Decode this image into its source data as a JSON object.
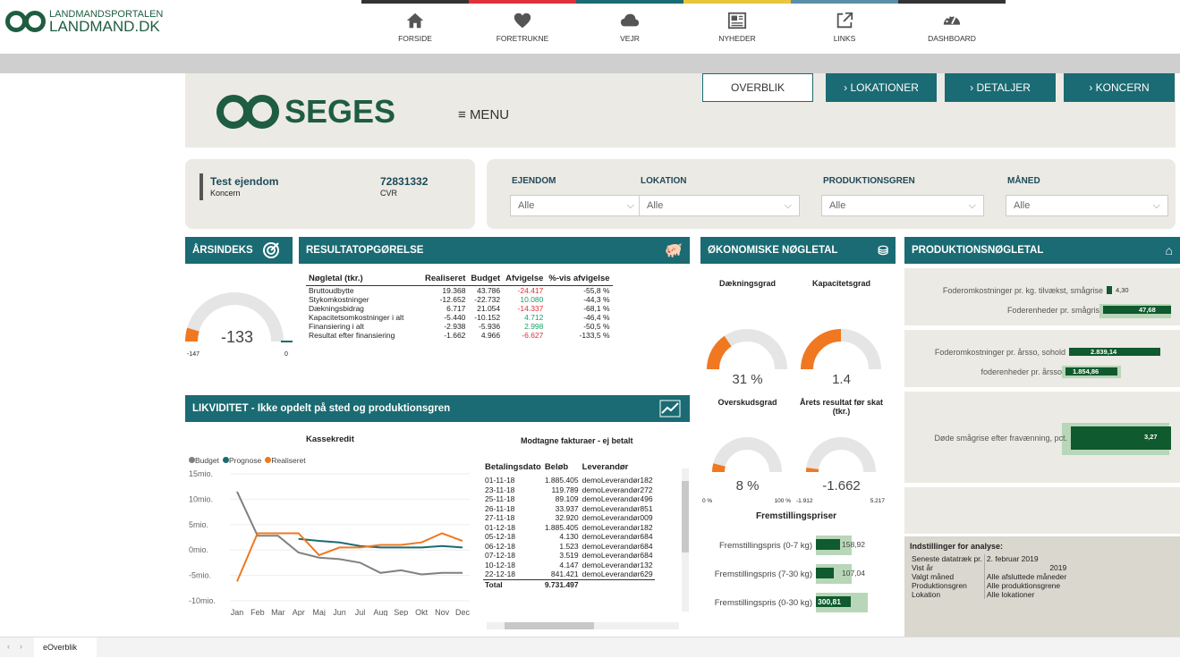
{
  "portal": {
    "line1": "LANDMANDSPORTALEN",
    "line2": "LANDMAND.DK"
  },
  "nav": [
    {
      "label": "FORSIDE",
      "icon": "home-icon",
      "color": "#333333"
    },
    {
      "label": "FORETRUKNE",
      "icon": "heart-icon",
      "color": "#e0303c"
    },
    {
      "label": "VEJR",
      "icon": "cloud-icon",
      "color": "#1a6b73"
    },
    {
      "label": "NYHEDER",
      "icon": "newspaper-icon",
      "color": "#e8c53a"
    },
    {
      "label": "LINKS",
      "icon": "external-link-icon",
      "color": "#5a8fa8"
    },
    {
      "label": "DASHBOARD",
      "icon": "dashboard-icon",
      "color": "#333333"
    }
  ],
  "brand": {
    "name": "SEGES",
    "menu": "MENU"
  },
  "tabs": {
    "overblik": "OVERBLIK",
    "lokationer": "LOKATIONER",
    "detaljer": "DETALJER",
    "koncern": "KONCERN"
  },
  "property": {
    "name": "Test ejendom",
    "type": "Koncern",
    "cvr": "72831332",
    "cvr_label": "CVR"
  },
  "filters": [
    {
      "label": "EJENDOM",
      "value": "Alle"
    },
    {
      "label": "LOKATION",
      "value": "Alle"
    },
    {
      "label": "PRODUKTIONSGREN",
      "value": "Alle"
    },
    {
      "label": "MÅNED",
      "value": "Alle"
    }
  ],
  "aarsindeks": {
    "title": "ÅRSINDEKS",
    "value": "-133",
    "min": "-147",
    "max": "0",
    "fill": 0.09
  },
  "resultat": {
    "title": "RESULTATOPGØRELSE",
    "headers": [
      "Nøgletal (tkr.)",
      "Realiseret",
      "Budget",
      "Afvigelse",
      "%-vis afvigelse"
    ],
    "rows": [
      [
        "Bruttoudbytte",
        "19.368",
        "43.786",
        "-24.417",
        "-55,8 %"
      ],
      [
        "Stykomkostninger",
        "-12.652",
        "-22.732",
        "10.080",
        "-44,3 %"
      ],
      [
        "Dækningsbidrag",
        "6.717",
        "21.054",
        "-14.337",
        "-68,1 %"
      ],
      [
        "Kapacitetsomkostninger i alt",
        "-5.440",
        "-10.152",
        "4.712",
        "-46,4 %"
      ],
      [
        "Finansiering i alt",
        "-2.938",
        "-5.936",
        "2.998",
        "-50,5 %"
      ],
      [
        "Resultat efter finansiering",
        "-1.662",
        "4.966",
        "-6.627",
        "-133,5 %"
      ]
    ],
    "afv_color": [
      "red",
      "grn",
      "red",
      "grn",
      "grn",
      "red"
    ]
  },
  "oko": {
    "title": "ØKONOMISKE NØGLETAL",
    "gauges": [
      {
        "label": "Dækningsgrad",
        "value": "31 %",
        "fill": 0.31
      },
      {
        "label": "Kapacitetsgrad",
        "value": "1.4",
        "fill": 0.5
      },
      {
        "label": "Overskudsgrad",
        "value": "8 %",
        "fill": 0.08,
        "min": "0 %",
        "max": "100 %"
      },
      {
        "label": "Årets resultat før skat (tkr.)",
        "value": "-1.662",
        "fill": 0.04,
        "min": "-1.912",
        "max": "5.217"
      }
    ]
  },
  "fremstilling": {
    "title": "Fremstillingspriser",
    "rows": [
      {
        "label": "Fremstillingspris (0-7 kg)",
        "value": "158,92",
        "fill": 0.55
      },
      {
        "label": "Fremstillingspris (7-30 kg)",
        "value": "107,04",
        "fill": 0.35
      },
      {
        "label": "Fremstillingspris (0-30 kg)",
        "value": "300,81",
        "fill": 0.9
      }
    ]
  },
  "prod": {
    "title": "PRODUKTIONSNØGLETAL",
    "rows": [
      {
        "label": "Foderomkostninger pr. kg. tilvækst, smågrise",
        "value": "4,30",
        "fill": 0.05
      },
      {
        "label": "Foderenheder pr. smågris",
        "value": "47,68",
        "fill": 0.85
      },
      {
        "label": "Foderomkostninger pr. årsso, sohold",
        "value": "2.839,14",
        "fill": 0.85
      },
      {
        "label": "foderenheder pr. årsso",
        "value": "1.854,86",
        "fill": 0.6
      },
      {
        "label": "Døde smågrise efter fravænning, pct.",
        "value": "3,27",
        "fill": 0.9
      }
    ]
  },
  "likviditet": {
    "title": "LIKVIDITET - Ikke opdelt på sted og produktionsgren",
    "chart_title": "Kassekredit",
    "legend": [
      "Budget",
      "Prognose",
      "Realiseret"
    ]
  },
  "chart_data": {
    "type": "line",
    "title": "Kassekredit",
    "categories": [
      "Jan",
      "Feb",
      "Mar",
      "Apr",
      "Maj",
      "Jun",
      "Jul",
      "Aug",
      "Sep",
      "Okt",
      "Nov",
      "Dec"
    ],
    "yticks": [
      "15mio.",
      "10mio.",
      "5mio.",
      "0mio.",
      "-5mio.",
      "-10mio."
    ],
    "ylim": [
      -10,
      15
    ],
    "series": [
      {
        "name": "Budget",
        "color": "#808080",
        "values": [
          11.5,
          2.8,
          2.8,
          -0.5,
          -1.5,
          -1.8,
          -2.5,
          -4.5,
          -4.0,
          -4.8,
          -4.5,
          -4.5
        ]
      },
      {
        "name": "Prognose",
        "color": "#1a6b73",
        "values": [
          null,
          null,
          null,
          2.2,
          1.8,
          1.5,
          0.8,
          0.5,
          0.5,
          0.5,
          0.8,
          0.5
        ]
      },
      {
        "name": "Realiseret",
        "color": "#f07820",
        "values": [
          -6.2,
          3.3,
          3.3,
          3.3,
          -1.0,
          0.5,
          0.5,
          1.0,
          1.0,
          1.5,
          3.3,
          1.8
        ]
      }
    ]
  },
  "fakturaer": {
    "title": "Modtagne fakturaer - ej betalt",
    "headers": [
      "Betalingsdato",
      "Beløb",
      "Leverandør"
    ],
    "rows": [
      [
        "01-11-18",
        "1.885.405",
        "demoLeverandør182"
      ],
      [
        "23-11-18",
        "119.789",
        "demoLeverandør272"
      ],
      [
        "25-11-18",
        "89.109",
        "demoLeverandør496"
      ],
      [
        "26-11-18",
        "33.937",
        "demoLeverandør851"
      ],
      [
        "27-11-18",
        "32.920",
        "demoLeverandør009"
      ],
      [
        "01-12-18",
        "1.885.405",
        "demoLeverandør182"
      ],
      [
        "05-12-18",
        "4.130",
        "demoLeverandør684"
      ],
      [
        "06-12-18",
        "1.523",
        "demoLeverandør684"
      ],
      [
        "07-12-18",
        "3.519",
        "demoLeverandør684"
      ],
      [
        "10-12-18",
        "4.147",
        "demoLeverandør132"
      ],
      [
        "22-12-18",
        "841.421",
        "demoLeverandør629"
      ]
    ],
    "total_label": "Total",
    "total": "9.731.497"
  },
  "indstillinger": {
    "title": "Indstillinger for analyse:",
    "rows": [
      [
        "Seneste datatræk pr.",
        "2. februar 2019"
      ],
      [
        "Vist år",
        "2019"
      ],
      [
        "Valgt måned",
        "Alle afsluttede måneder"
      ],
      [
        "Produktionsgren",
        "Alle produktionsgrene"
      ],
      [
        "Lokation",
        "Alle lokationer"
      ]
    ]
  },
  "footer": {
    "tab": "eOverblik"
  }
}
